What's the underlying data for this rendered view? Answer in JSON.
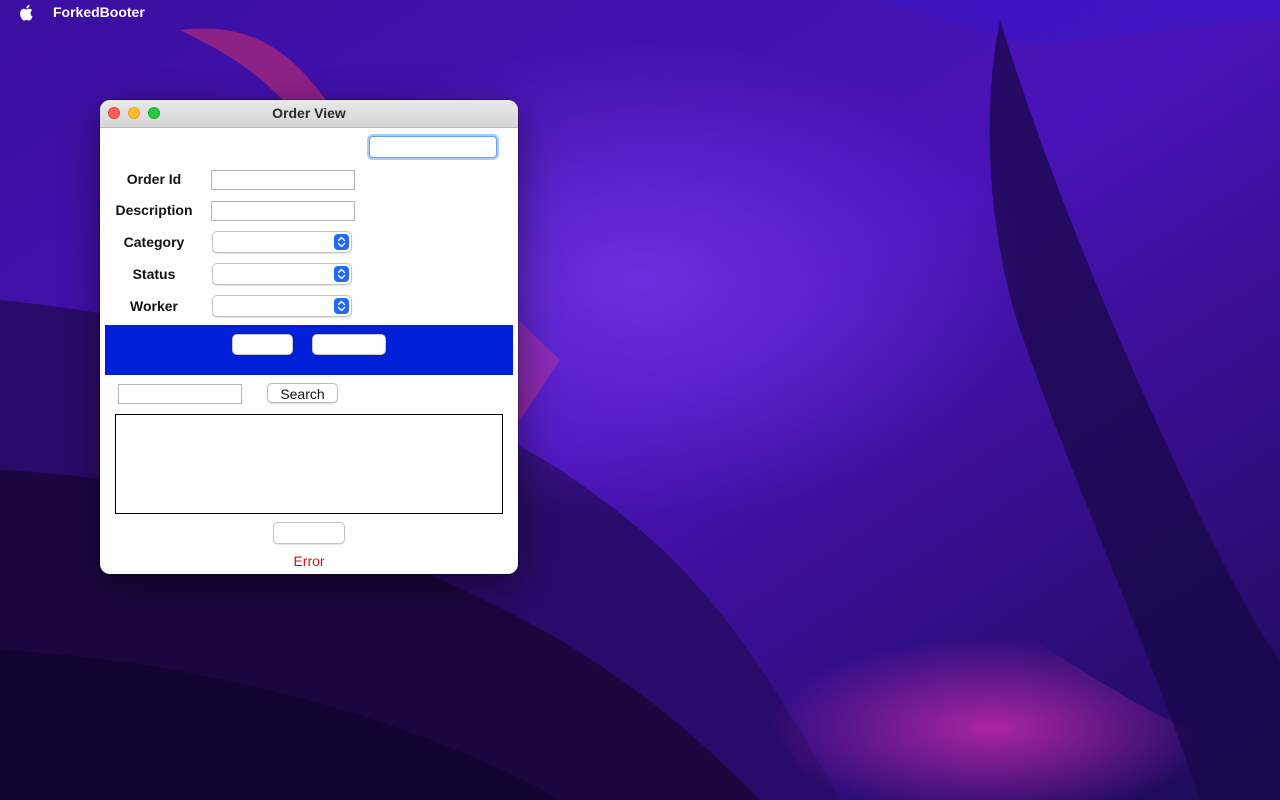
{
  "menubar": {
    "app_name": "ForkedBooter"
  },
  "window": {
    "title": "Order View"
  },
  "form": {
    "top_field": {
      "value": ""
    },
    "order_id": {
      "label": "Order Id",
      "value": ""
    },
    "description": {
      "label": "Description",
      "value": ""
    },
    "category": {
      "label": "Category",
      "selected": ""
    },
    "status": {
      "label": "Status",
      "selected": ""
    },
    "worker": {
      "label": "Worker",
      "selected": ""
    }
  },
  "actions": {
    "button_1_label": "",
    "button_2_label": ""
  },
  "search": {
    "value": "",
    "button_label": "Search"
  },
  "results": {
    "items": []
  },
  "bottom": {
    "button_label": "",
    "error_text": "Error"
  },
  "colors": {
    "action_band": "#0020d8",
    "error": "#d81010",
    "select_arrow": "#1f6cf3"
  },
  "icons": {
    "apple": "apple-icon",
    "select_arrow": "chevron-updown-icon"
  }
}
